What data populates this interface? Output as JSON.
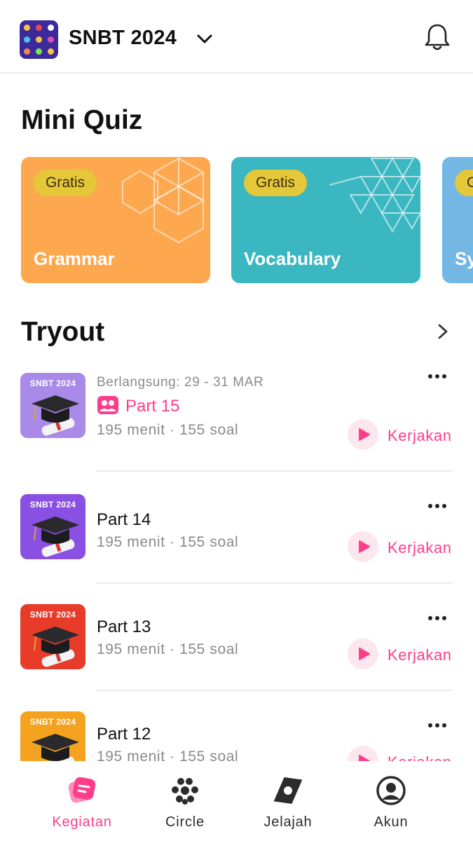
{
  "header": {
    "title": "SNBT 2024",
    "logo_icon": "program-logo-icon",
    "dropdown_icon": "chevron-down-icon",
    "notification_icon": "bell-icon"
  },
  "mini_quiz": {
    "title": "Mini Quiz",
    "cards": [
      {
        "badge": "Gratis",
        "name": "Grammar",
        "color": "#fda84f"
      },
      {
        "badge": "Gratis",
        "name": "Vocabulary",
        "color": "#3bb7c1"
      },
      {
        "badge": "Gratis",
        "name": "Sy",
        "color": "#74b6e4"
      }
    ]
  },
  "tryout": {
    "title": "Tryout",
    "see_all_icon": "chevron-right-icon",
    "items": [
      {
        "thumb_label": "SNBT 2024",
        "status": "Berlangsung: 29 - 31 MAR",
        "title": "Part 15",
        "detail": "195 menit · 155 soal",
        "action": "Kerjakan",
        "thumb_color": "#a98ae8"
      },
      {
        "thumb_label": "SNBT 2024",
        "status": "",
        "title": "Part 14",
        "detail": "195 menit · 155 soal",
        "action": "Kerjakan",
        "thumb_color": "#8a4fe3"
      },
      {
        "thumb_label": "SNBT 2024",
        "status": "",
        "title": "Part 13",
        "detail": "195 menit · 155 soal",
        "action": "Kerjakan",
        "thumb_color": "#e83b2a"
      },
      {
        "thumb_label": "SNBT 2024",
        "status": "",
        "title": "Part 12",
        "detail": "195 menit · 155 soal",
        "action": "Kerjakan",
        "thumb_color": "#f5a31f"
      }
    ]
  },
  "bottom_nav": {
    "items": [
      {
        "label": "Kegiatan",
        "icon": "kegiatan-icon",
        "active": true
      },
      {
        "label": "Circle",
        "icon": "circle-group-icon",
        "active": false
      },
      {
        "label": "Jelajah",
        "icon": "compass-icon",
        "active": false
      },
      {
        "label": "Akun",
        "icon": "account-icon",
        "active": false
      }
    ]
  },
  "colors": {
    "accent": "#ff3d8b",
    "badge": "#e5c73a"
  }
}
